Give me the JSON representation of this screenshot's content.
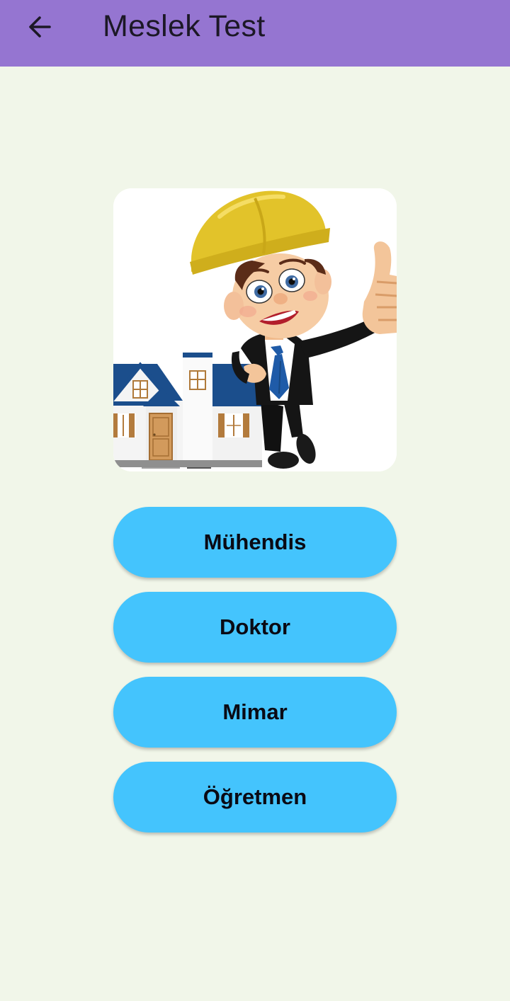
{
  "appbar": {
    "title": "Meslek Test",
    "back_icon": "arrow-left-icon",
    "background": "#9575d1"
  },
  "question_image": {
    "subject": "engineer-character-with-house"
  },
  "answers": [
    {
      "label": "Mühendis"
    },
    {
      "label": "Doktor"
    },
    {
      "label": "Mimar"
    },
    {
      "label": "Öğretmen"
    }
  ],
  "colors": {
    "page_background": "#f1f6e9",
    "button_background": "#44c4fd",
    "button_text": "#0a0a14"
  }
}
